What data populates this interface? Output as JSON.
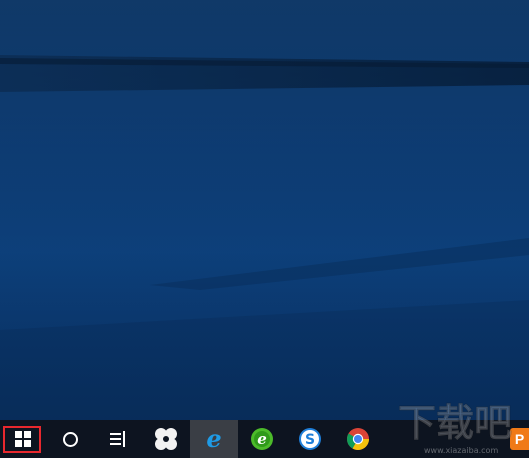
{
  "desktop": {
    "accent_color": "#0c3e78",
    "taskbar_color": "#0d1420",
    "highlight_color": "#e8282e"
  },
  "taskbar": {
    "items": [
      {
        "icon": "windows-start-icon",
        "highlighted": true
      },
      {
        "icon": "cortana-search-icon"
      },
      {
        "icon": "task-view-icon"
      },
      {
        "icon": "pinwheel-app-icon"
      },
      {
        "icon": "internet-explorer-icon",
        "active": true
      },
      {
        "icon": "green-browser-icon"
      },
      {
        "icon": "sogou-browser-icon"
      },
      {
        "icon": "chrome-icon"
      }
    ],
    "tray_label": "P"
  },
  "watermark": {
    "text": "下载吧",
    "url": "www.xiazaiba.com"
  }
}
